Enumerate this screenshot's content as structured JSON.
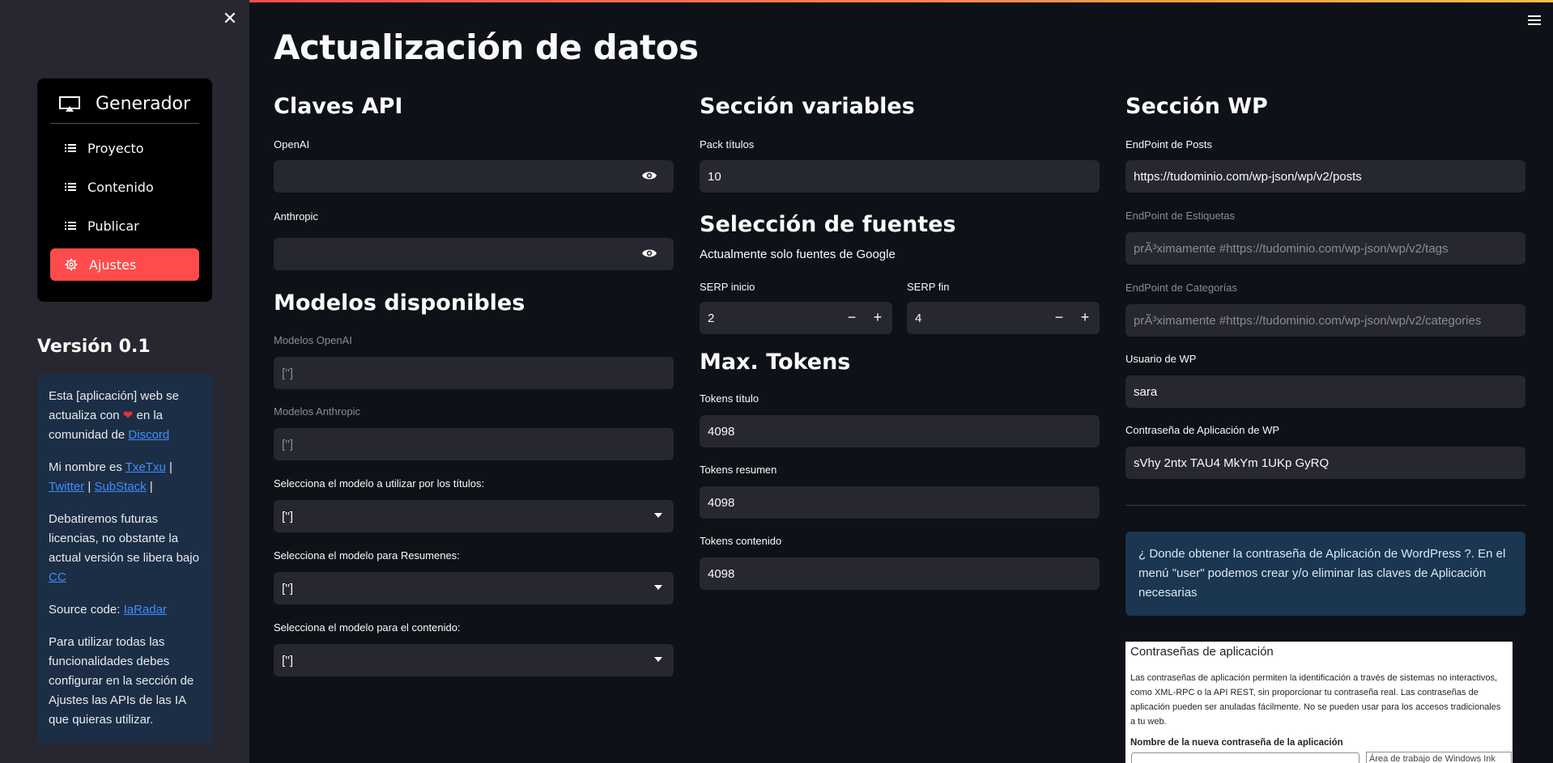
{
  "sidebar": {
    "nav_title": "Generador",
    "items": [
      {
        "label": "Proyecto"
      },
      {
        "label": "Contenido"
      },
      {
        "label": "Publicar"
      },
      {
        "label": "Ajustes"
      }
    ],
    "version": "Versión 0.1",
    "info": {
      "p1_a": "Esta [aplicación] web se actualiza con",
      "p1_b": "en la comunidad de",
      "p1_link": "Discord",
      "p2_a": "Mi nombre es",
      "p2_link1": "TxeTxu",
      "sep": "|",
      "p2_link2": "Twitter",
      "p2_link3": "SubStack",
      "p3_a": "Debatiremos futuras licencias, no obstante la actual versión se libera bajo",
      "p3_link": "CC",
      "p4_a": "Source code:",
      "p4_link": "IaRadar",
      "p5": "Para utilizar todas las funcionalidades debes configurar en la sección de Ajustes las APIs de las IA que quieras utilizar."
    },
    "accent_color": "#ff4b4b"
  },
  "main": {
    "title": "Actualización de datos",
    "api": {
      "heading": "Claves API",
      "openai_label": "OpenAI",
      "anthropic_label": "Anthropic"
    },
    "models": {
      "heading": "Modelos disponibles",
      "openai_label": "Modelos OpenAI",
      "openai_value": "['']",
      "anthropic_label": "Modelos Anthropic",
      "anthropic_value": "['']",
      "titles_label": "Selecciona el modelo a utilizar por los títulos:",
      "titles_value": "['']",
      "summary_label": "Selecciona el modelo para Resumenes:",
      "summary_value": "['']",
      "content_label": "Selecciona el modelo para el contenido:",
      "content_value": "['']"
    },
    "variables": {
      "heading": "Sección variables",
      "pack_label": "Pack títulos",
      "pack_value": "10"
    },
    "sources": {
      "heading": "Selección de fuentes",
      "note": "Actualmente solo fuentes de Google",
      "serp_start_label": "SERP inicio",
      "serp_start_value": "2",
      "serp_end_label": "SERP fin",
      "serp_end_value": "4",
      "minus": "−",
      "plus": "+"
    },
    "tokens": {
      "heading": "Max. Tokens",
      "title_label": "Tokens título",
      "title_value": "4098",
      "summary_label": "Tokens resumen",
      "summary_value": "4098",
      "content_label": "Tokens contenido",
      "content_value": "4098"
    },
    "wp": {
      "heading": "Sección WP",
      "posts_label": "EndPoint de Posts",
      "posts_value": "https://tudominio.com/wp-json/wp/v2/posts",
      "tags_label": "EndPoint de Estiquetas",
      "tags_value": "prÃ³ximamente #https://tudominio.com/wp-json/wp/v2/tags",
      "cats_label": "EndPoint de Categorías",
      "cats_value": "prÃ³ximamente #https://tudominio.com/wp-json/wp/v2/categories",
      "user_label": "Usuario de WP",
      "user_value": "sara",
      "pass_label": "Contraseña de Aplicación de WP",
      "pass_value": "sVhy 2ntx TAU4 MkYm 1UKp GyRQ",
      "callout": "¿ Donde obtener la contraseña de Aplicación de WordPress ?. En el menú \"user\" podemos crear y/o eliminar las claves de Aplicación necesarias"
    },
    "embedded_screenshot": {
      "title": "Contraseñas de aplicación",
      "paragraph": "Las contraseñas de aplicación permiten la identificación a través de sistemas no interactivos, como XML-RPC o la API REST, sin proporcionar tu contraseña real. Las contraseñas de aplicación pueden ser anuladas fácilmente. No se pueden usar para los accesos tradicionales a tu web.",
      "field_label": "Nombre de la nueva contraseña de la aplicación",
      "side_box": "Área de trabajo de Windows Ink"
    }
  }
}
